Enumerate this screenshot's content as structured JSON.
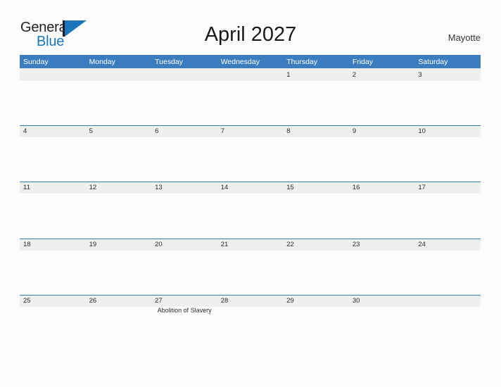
{
  "brand": {
    "word_one": "General",
    "word_two": "Blue",
    "mark": "flag-triangle-icon",
    "color_dark": "#231f20",
    "color_blue": "#1b75bb"
  },
  "header": {
    "title": "April 2027",
    "location": "Mayotte"
  },
  "theme": {
    "header_blue": "#3b7cbe",
    "date_band_gray": "#efefef",
    "page_background": "#fcfcfc",
    "cell_white": "#fdfdfd",
    "text_dark": "#2b2b2b"
  },
  "calendar": {
    "month": "April",
    "year": "2027",
    "weekdays": [
      "Sunday",
      "Monday",
      "Tuesday",
      "Wednesday",
      "Thursday",
      "Friday",
      "Saturday"
    ],
    "weeks": [
      [
        {
          "day": ""
        },
        {
          "day": ""
        },
        {
          "day": ""
        },
        {
          "day": ""
        },
        {
          "day": "1"
        },
        {
          "day": "2"
        },
        {
          "day": "3"
        }
      ],
      [
        {
          "day": "4"
        },
        {
          "day": "5"
        },
        {
          "day": "6"
        },
        {
          "day": "7"
        },
        {
          "day": "8"
        },
        {
          "day": "9"
        },
        {
          "day": "10"
        }
      ],
      [
        {
          "day": "11"
        },
        {
          "day": "12"
        },
        {
          "day": "13"
        },
        {
          "day": "14"
        },
        {
          "day": "15"
        },
        {
          "day": "16"
        },
        {
          "day": "17"
        }
      ],
      [
        {
          "day": "18"
        },
        {
          "day": "19"
        },
        {
          "day": "20"
        },
        {
          "day": "21"
        },
        {
          "day": "22"
        },
        {
          "day": "23"
        },
        {
          "day": "24"
        }
      ],
      [
        {
          "day": "25"
        },
        {
          "day": "26"
        },
        {
          "day": "27",
          "event": "Abolition of Slavery"
        },
        {
          "day": "28"
        },
        {
          "day": "29"
        },
        {
          "day": "30"
        },
        {
          "day": ""
        }
      ]
    ]
  }
}
